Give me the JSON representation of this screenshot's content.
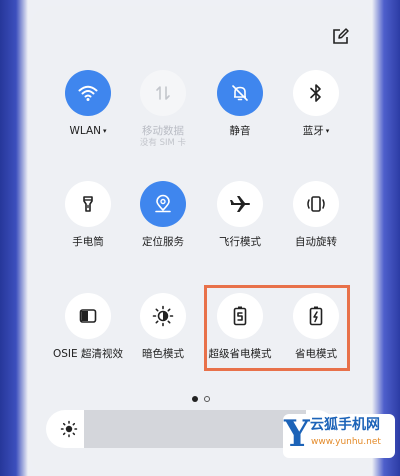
{
  "quick_settings": {
    "tiles": [
      {
        "id": "wlan",
        "label": "WLAN",
        "caret": "▾",
        "state": "on",
        "icon": "wifi-icon"
      },
      {
        "id": "mobile_data",
        "label": "移动数据",
        "sublabel": "没有 SIM 卡",
        "state": "disabled",
        "icon": "mobile-data-icon"
      },
      {
        "id": "mute",
        "label": "静音",
        "state": "on",
        "icon": "bell-mute-icon"
      },
      {
        "id": "bluetooth",
        "label": "蓝牙",
        "caret": "▾",
        "state": "off",
        "icon": "bluetooth-icon"
      },
      {
        "id": "flashlight",
        "label": "手电筒",
        "state": "off",
        "icon": "flashlight-icon"
      },
      {
        "id": "location",
        "label": "定位服务",
        "state": "on",
        "icon": "location-icon"
      },
      {
        "id": "airplane",
        "label": "飞行模式",
        "state": "off",
        "icon": "airplane-icon"
      },
      {
        "id": "auto_rotate",
        "label": "自动旋转",
        "state": "off",
        "icon": "rotate-icon"
      },
      {
        "id": "osie",
        "label": "OSIE 超清视效",
        "state": "off",
        "icon": "osie-icon"
      },
      {
        "id": "dark_mode",
        "label": "暗色模式",
        "state": "off",
        "icon": "dark-mode-icon"
      },
      {
        "id": "super_power_saving",
        "label": "超级省电模式",
        "state": "off",
        "icon": "super-battery-icon"
      },
      {
        "id": "power_saving",
        "label": "省电模式",
        "state": "off",
        "icon": "battery-saver-icon"
      }
    ],
    "page_indicator": {
      "pages": 2,
      "current": 1
    },
    "edit_icon": "edit-icon",
    "brightness_icon": "brightness-icon"
  },
  "watermark": {
    "letter": "Y",
    "text": "云狐手机网",
    "url": "www.yunhu.net"
  },
  "colors": {
    "accent": "#3f86ee",
    "highlight": "#e8714a",
    "watermark_blue": "#1c63b8",
    "watermark_orange": "#e48b2a"
  }
}
